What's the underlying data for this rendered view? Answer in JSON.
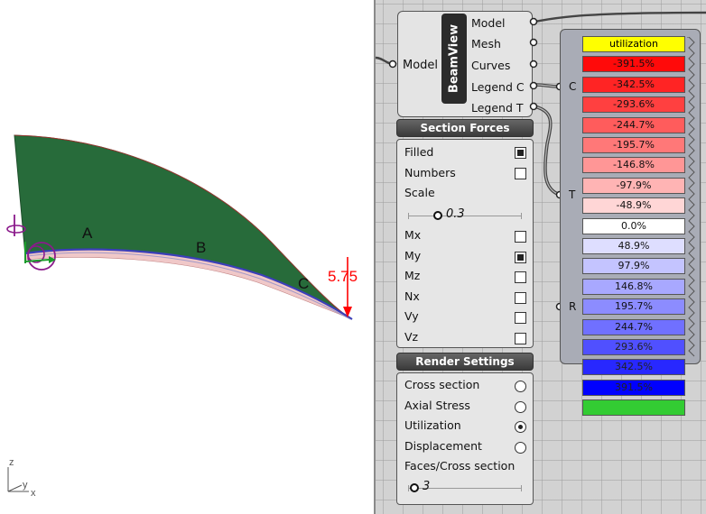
{
  "viewport": {
    "beam_labels": {
      "a": "A",
      "b": "B",
      "c": "C"
    },
    "load_value": "5.75",
    "axes": {
      "z": "z",
      "y": "y",
      "x": "x"
    }
  },
  "beamview": {
    "title": "BeamView",
    "input_label": "Model",
    "outputs": [
      "Model",
      "Mesh",
      "Curves",
      "Legend C",
      "Legend T"
    ]
  },
  "section_forces": {
    "title": "Section Forces",
    "filled": {
      "label": "Filled",
      "checked": true
    },
    "numbers": {
      "label": "Numbers",
      "checked": false
    },
    "scale": {
      "label": "Scale",
      "value": "0.3",
      "fraction": 0.33
    },
    "components": [
      {
        "label": "Mx",
        "checked": false
      },
      {
        "label": "My",
        "checked": true
      },
      {
        "label": "Mz",
        "checked": false
      },
      {
        "label": "Nx",
        "checked": false
      },
      {
        "label": "Vy",
        "checked": false
      },
      {
        "label": "Vz",
        "checked": false
      }
    ]
  },
  "render_settings": {
    "title": "Render Settings",
    "options": [
      {
        "label": "Cross section",
        "selected": false
      },
      {
        "label": "Axial Stress",
        "selected": false
      },
      {
        "label": "Utilization",
        "selected": true
      },
      {
        "label": "Displacement",
        "selected": false
      }
    ],
    "faces": {
      "label": "Faces/Cross section",
      "value": "3",
      "fraction": 0.0
    }
  },
  "legend": {
    "ports": [
      "C",
      "T",
      "R"
    ],
    "title": "utilization",
    "title_color": "#ffff00",
    "bottom_color": "#33cc33",
    "entries": [
      {
        "text": "-391.5%",
        "color": "#ff0a0a"
      },
      {
        "text": "-342.5%",
        "color": "#ff2424"
      },
      {
        "text": "-293.6%",
        "color": "#ff4040"
      },
      {
        "text": "-244.7%",
        "color": "#ff5c5c"
      },
      {
        "text": "-195.7%",
        "color": "#ff7878"
      },
      {
        "text": "-146.8%",
        "color": "#ff9696"
      },
      {
        "text": "-97.9%",
        "color": "#ffb4b4"
      },
      {
        "text": "-48.9%",
        "color": "#ffd6d6"
      },
      {
        "text": "0.0%",
        "color": "#ffffff"
      },
      {
        "text": "48.9%",
        "color": "#dedeff"
      },
      {
        "text": "97.9%",
        "color": "#c4c4ff"
      },
      {
        "text": "146.8%",
        "color": "#a8a8ff"
      },
      {
        "text": "195.7%",
        "color": "#8c8cff"
      },
      {
        "text": "244.7%",
        "color": "#7070ff"
      },
      {
        "text": "293.6%",
        "color": "#5050ff"
      },
      {
        "text": "342.5%",
        "color": "#2828ff"
      },
      {
        "text": "391.5%",
        "color": "#0000ff"
      }
    ]
  }
}
